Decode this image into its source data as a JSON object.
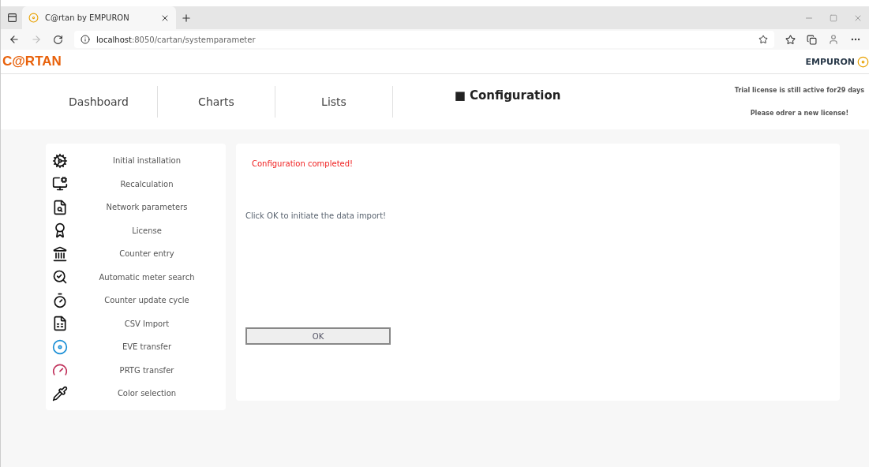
{
  "browser": {
    "tab_title": "C@rtan by EMPURON",
    "url_host": "localhost",
    "url_rest": ":8050/cartan/systemparameter"
  },
  "header": {
    "logo": "C@RTAN",
    "brand": "EMPURON"
  },
  "nav": [
    {
      "label": "Dashboard",
      "selected": false
    },
    {
      "label": "Charts",
      "selected": false
    },
    {
      "label": "Lists",
      "selected": false
    },
    {
      "label": "■ Configuration",
      "selected": true
    }
  ],
  "license": [
    "Trial license is still active for29 days",
    "Please odrer a new license!"
  ],
  "sidebar": {
    "items": [
      "Initial installation",
      "Recalculation",
      "Network parameters",
      "License",
      "Counter entry",
      "Automatic meter search",
      "Counter update cycle",
      "CSV Import",
      "EVE transfer",
      "PRTG transfer",
      "Color selection"
    ]
  },
  "main": {
    "status": "Configuration completed!",
    "instruction": "Click OK to initiate the data import!",
    "button": "OK"
  }
}
